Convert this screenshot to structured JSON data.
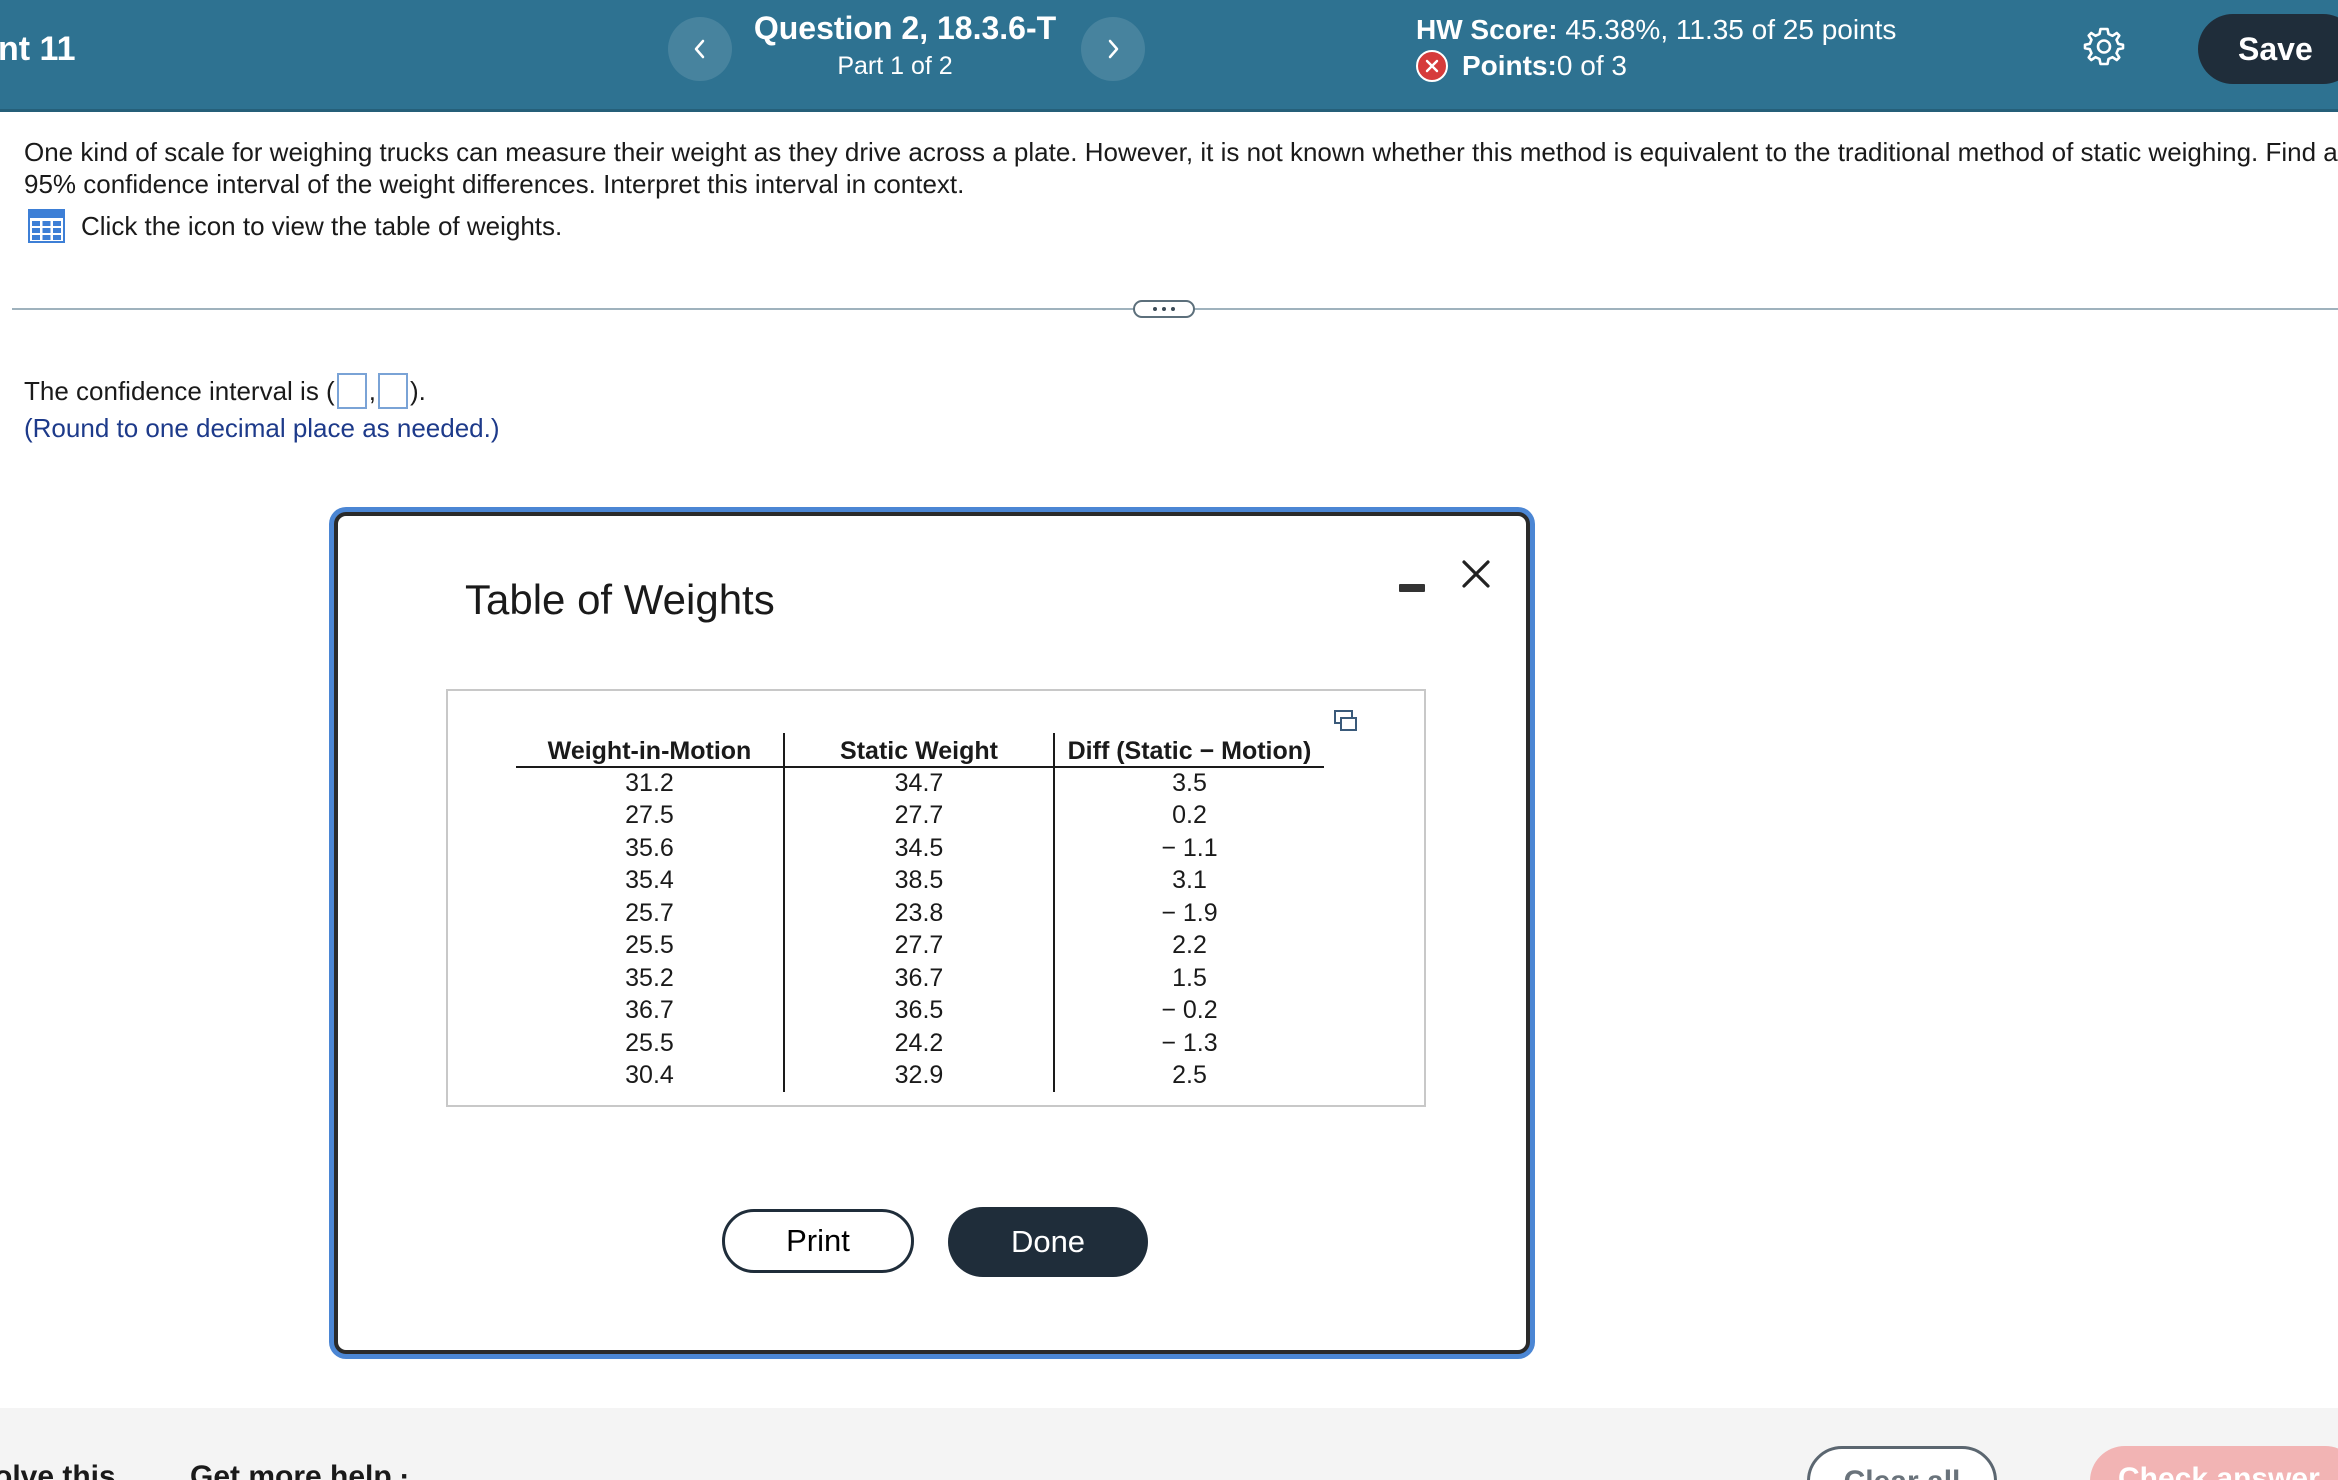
{
  "header": {
    "assignment_title": "nt 11",
    "question_title": "Question 2, 18.3.6-T",
    "part": "Part 1 of 2",
    "hw_score_label": "HW Score:",
    "hw_score_value": " 45.38%, 11.35 of 25 points",
    "points_label": "Points:",
    "points_value": " 0 of 3",
    "save_label": "Save",
    "prev_icon": "chevron-left-icon",
    "next_icon": "chevron-right-icon",
    "settings_icon": "gear-icon",
    "bg_color": "#2e7291"
  },
  "question": {
    "text": "One kind of scale for weighing trucks can measure their weight as they drive across a plate. However, it is not known whether this method is equivalent to the traditional method of static weighing. Find a 95% confidence interval of the weight differences. Interpret this interval in context.",
    "view_table_text": "Click the icon to view the table of weights.",
    "ci_prefix": "The confidence interval is (",
    "ci_sep": ",",
    "ci_suffix": ").",
    "round_note": "(Round to one decimal place as needed.)"
  },
  "modal": {
    "title": "Table of Weights",
    "columns": [
      "Weight-in-Motion",
      "Static Weight",
      "Diff (Static − Motion)"
    ],
    "rows": [
      [
        "31.2",
        "34.7",
        "3.5"
      ],
      [
        "27.5",
        "27.7",
        "0.2"
      ],
      [
        "35.6",
        "34.5",
        "− 1.1"
      ],
      [
        "35.4",
        "38.5",
        "3.1"
      ],
      [
        "25.7",
        "23.8",
        "− 1.9"
      ],
      [
        "25.5",
        "27.7",
        "2.2"
      ],
      [
        "35.2",
        "36.7",
        "1.5"
      ],
      [
        "36.7",
        "36.5",
        "− 0.2"
      ],
      [
        "25.5",
        "24.2",
        "− 1.3"
      ],
      [
        "30.4",
        "32.9",
        "2.5"
      ]
    ],
    "print_label": "Print",
    "done_label": "Done",
    "accent_color": "#4b86d4"
  },
  "footer": {
    "solve_label": "olve this",
    "help_label": "Get more help ·",
    "clear_label": "Clear all",
    "check_label": "Check answer"
  }
}
